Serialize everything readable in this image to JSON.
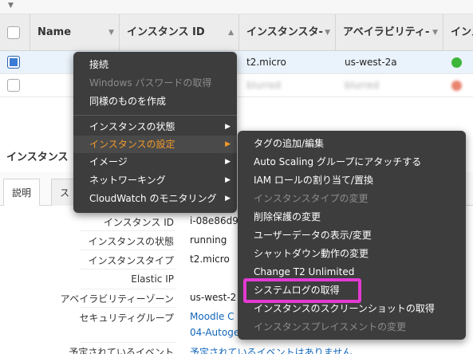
{
  "table": {
    "columns": [
      {
        "label": "Name"
      },
      {
        "label": "インスタンス ID"
      },
      {
        "label": "インスタンスタ‐"
      },
      {
        "label": "アベイラビリティ‐"
      },
      {
        "label": "インス"
      }
    ],
    "rows": [
      {
        "type": "t2.micro",
        "az": "us-west-2a",
        "status_color": "#3cb73c",
        "selected": true
      },
      {
        "type": "blurred",
        "az": "blurred",
        "status_color": "#e9846e",
        "selected": false
      }
    ]
  },
  "details": {
    "section_title": "インスタンス",
    "tabs": [
      {
        "label": "説明"
      },
      {
        "label": "ス"
      }
    ],
    "fields": [
      {
        "label": "インスタンス ID",
        "value": "i-08e86d9"
      },
      {
        "label": "インスタンスの状態",
        "value": "running"
      },
      {
        "label": "インスタンスタイプ",
        "value": "t2.micro"
      },
      {
        "label": "Elastic IP",
        "value": ""
      },
      {
        "label": "アベイラビリティーゾーン",
        "value": "us-west-2"
      },
      {
        "label": "セキュリティグループ",
        "value": "Moodle C"
      },
      {
        "label": "",
        "value": "04-Autoge"
      },
      {
        "label": "予定されているイベント",
        "value": "予定されているイベントはありません"
      }
    ]
  },
  "context_menu": {
    "items": [
      {
        "label": "接続",
        "disabled": false
      },
      {
        "label": "Windows パスワードの取得",
        "disabled": true
      },
      {
        "label": "同様のものを作成",
        "disabled": false
      },
      {
        "label": "インスタンスの状態",
        "submenu": true
      },
      {
        "label": "インスタンスの設定",
        "submenu": true,
        "highlighted": true
      },
      {
        "label": "イメージ",
        "submenu": true
      },
      {
        "label": "ネットワーキング",
        "submenu": true
      },
      {
        "label": "CloudWatch のモニタリング",
        "submenu": true
      }
    ]
  },
  "submenu": {
    "items": [
      {
        "label": "タグの追加/編集",
        "disabled": false
      },
      {
        "label": "Auto Scaling グループにアタッチする",
        "disabled": false
      },
      {
        "label": "IAM ロールの割り当て/置換",
        "disabled": false
      },
      {
        "label": "インスタンスタイプの変更",
        "disabled": true
      },
      {
        "label": "削除保護の変更",
        "disabled": false
      },
      {
        "label": "ユーザーデータの表示/変更",
        "disabled": false
      },
      {
        "label": "シャットダウン動作の変更",
        "disabled": false
      },
      {
        "label": "Change T2 Unlimited",
        "disabled": false
      },
      {
        "label": "システムログの取得",
        "disabled": false,
        "callout": true
      },
      {
        "label": "インスタンスのスクリーンショットの取得",
        "disabled": false
      },
      {
        "label": "インスタンスプレイスメントの変更",
        "disabled": true
      }
    ]
  },
  "colors": {
    "menu_bg": "#3d3d3d",
    "highlight_text": "#f39a2c",
    "callout_border": "#e33ad1",
    "link": "#1166bb"
  }
}
